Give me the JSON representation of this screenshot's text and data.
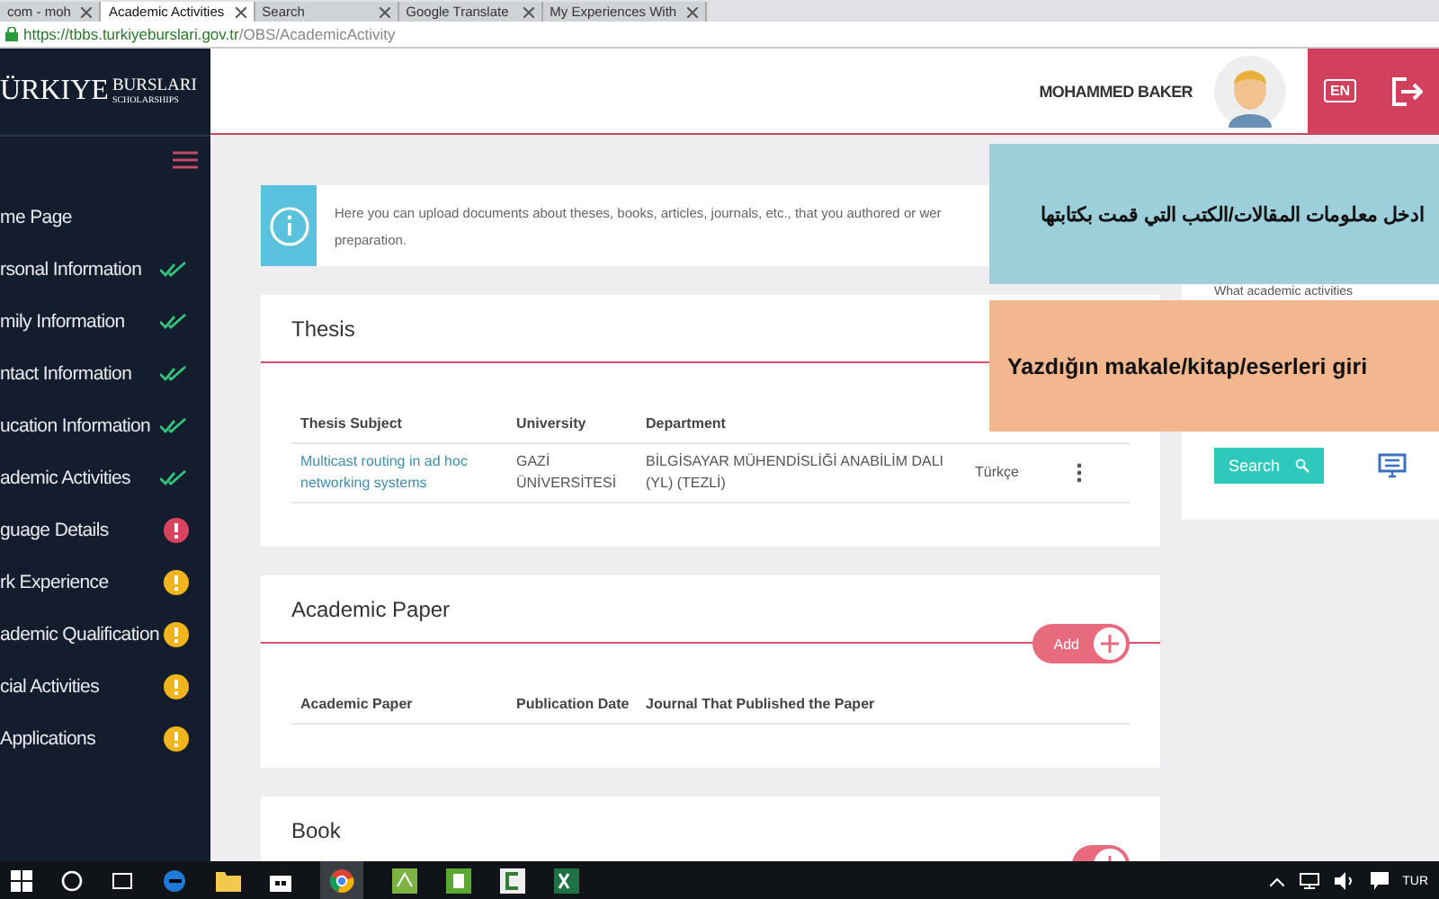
{
  "browser": {
    "tabs": [
      {
        "label": "com - moh",
        "selected": false
      },
      {
        "label": "Academic Activities",
        "selected": true
      },
      {
        "label": "Search",
        "selected": false
      },
      {
        "label": "Google Translate",
        "selected": false
      },
      {
        "label": "My Experiences With",
        "selected": false
      }
    ],
    "url_host": "https://tbbs.turkiyeburslari.gov.tr",
    "url_path": "/OBS/AcademicActivity"
  },
  "header": {
    "logo_main": "ÜRKIYE",
    "logo_top": "BURSLARI",
    "logo_sub": "SCHOLARSHIPS",
    "user_name": "MOHAMMED BAKER",
    "language": "EN"
  },
  "sidebar": {
    "items": [
      {
        "label": "me Page"
      },
      {
        "label": "rsonal Information",
        "kind": "done"
      },
      {
        "label": "mily Information",
        "kind": "done"
      },
      {
        "label": "ntact Information",
        "kind": "done"
      },
      {
        "label": "ucation Information",
        "kind": "done"
      },
      {
        "label": "ademic Activities",
        "kind": "done"
      },
      {
        "label": "guage Details",
        "kind": "error"
      },
      {
        "label": "rk Experience",
        "kind": "warning"
      },
      {
        "label": "ademic Qualification",
        "kind": "warning"
      },
      {
        "label": "cial Activities",
        "kind": "warning"
      },
      {
        "label": "Applications",
        "kind": "warning"
      }
    ]
  },
  "info": {
    "lines": [
      "Here you can upload documents about theses, books, articles, journals, etc., that you authored or wer",
      "preparation."
    ]
  },
  "sections": [
    {
      "title": "Thesis",
      "columns": [
        "Thesis Subject",
        "University",
        "Department"
      ],
      "rows": [
        {
          "subject": "Multicast routing in ad hoc networking systems",
          "university": "GAZİ ÜNİVERSİTESİ",
          "department": "BİLGİSAYAR MÜHENDİSLİĞİ ANABİLİM DALI (YL) (TEZLİ)",
          "language": "Türkçe"
        }
      ]
    },
    {
      "title": "Academic Paper",
      "add_button": true,
      "add_label": "Add",
      "columns": [
        "Academic Paper",
        "Publication Date",
        "Journal That Published the Paper"
      ]
    },
    {
      "title": "Book",
      "add_button": true
    }
  ],
  "side_panel": {
    "prompt": "What academic activities",
    "search_label": "Search"
  },
  "captions": [
    {
      "text": "ادخل معلومات المقالات/الكتب التي قمت بكتابتها",
      "color": "#9ccfda"
    },
    {
      "text": "Yazdığın makale/kitap/eserleri giri",
      "color": "#f2b78e"
    }
  ],
  "taskbar": {
    "language": "TUR"
  }
}
